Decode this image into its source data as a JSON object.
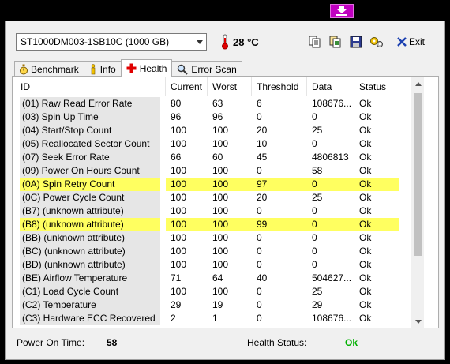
{
  "drive_select": {
    "value": "ST1000DM003-1SB10C (1000 GB)"
  },
  "temperature": {
    "value": "28 °C"
  },
  "exit_label": "Exit",
  "tabs": [
    {
      "label": "Benchmark",
      "icon": "stopwatch-icon"
    },
    {
      "label": "Info",
      "icon": "info-icon"
    },
    {
      "label": "Health",
      "icon": "red-cross-icon",
      "active": true
    },
    {
      "label": "Error Scan",
      "icon": "magnifier-icon"
    }
  ],
  "columns": [
    "ID",
    "Current",
    "Worst",
    "Threshold",
    "Data",
    "Status"
  ],
  "rows": [
    {
      "id": "(01) Raw Read Error Rate",
      "current": "80",
      "worst": "63",
      "threshold": "6",
      "data": "108676...",
      "status": "Ok"
    },
    {
      "id": "(03) Spin Up Time",
      "current": "96",
      "worst": "96",
      "threshold": "0",
      "data": "0",
      "status": "Ok"
    },
    {
      "id": "(04) Start/Stop Count",
      "current": "100",
      "worst": "100",
      "threshold": "20",
      "data": "25",
      "status": "Ok"
    },
    {
      "id": "(05) Reallocated Sector Count",
      "current": "100",
      "worst": "100",
      "threshold": "10",
      "data": "0",
      "status": "Ok"
    },
    {
      "id": "(07) Seek Error Rate",
      "current": "66",
      "worst": "60",
      "threshold": "45",
      "data": "4806813",
      "status": "Ok"
    },
    {
      "id": "(09) Power On Hours Count",
      "current": "100",
      "worst": "100",
      "threshold": "0",
      "data": "58",
      "status": "Ok"
    },
    {
      "id": "(0A) Spin Retry Count",
      "current": "100",
      "worst": "100",
      "threshold": "97",
      "data": "0",
      "status": "Ok",
      "highlight": true
    },
    {
      "id": "(0C) Power Cycle Count",
      "current": "100",
      "worst": "100",
      "threshold": "20",
      "data": "25",
      "status": "Ok"
    },
    {
      "id": "(B7) (unknown attribute)",
      "current": "100",
      "worst": "100",
      "threshold": "0",
      "data": "0",
      "status": "Ok"
    },
    {
      "id": "(B8) (unknown attribute)",
      "current": "100",
      "worst": "100",
      "threshold": "99",
      "data": "0",
      "status": "Ok",
      "highlight": true
    },
    {
      "id": "(BB) (unknown attribute)",
      "current": "100",
      "worst": "100",
      "threshold": "0",
      "data": "0",
      "status": "Ok"
    },
    {
      "id": "(BC) (unknown attribute)",
      "current": "100",
      "worst": "100",
      "threshold": "0",
      "data": "0",
      "status": "Ok"
    },
    {
      "id": "(BD) (unknown attribute)",
      "current": "100",
      "worst": "100",
      "threshold": "0",
      "data": "0",
      "status": "Ok"
    },
    {
      "id": "(BE) Airflow Temperature",
      "current": "71",
      "worst": "64",
      "threshold": "40",
      "data": "504627...",
      "status": "Ok"
    },
    {
      "id": "(C1) Load Cycle Count",
      "current": "100",
      "worst": "100",
      "threshold": "0",
      "data": "25",
      "status": "Ok"
    },
    {
      "id": "(C2) Temperature",
      "current": "29",
      "worst": "19",
      "threshold": "0",
      "data": "29",
      "status": "Ok"
    },
    {
      "id": "(C3) Hardware ECC Recovered",
      "current": "2",
      "worst": "1",
      "threshold": "0",
      "data": "108676...",
      "status": "Ok"
    }
  ],
  "status_bar": {
    "power_on_label": "Power On Time:",
    "power_on_value": "58",
    "health_label": "Health Status:",
    "health_value": "Ok",
    "health_color": "#00b000"
  },
  "colors": {
    "highlight": "#ffff60",
    "temp_icon": "#e00000"
  }
}
